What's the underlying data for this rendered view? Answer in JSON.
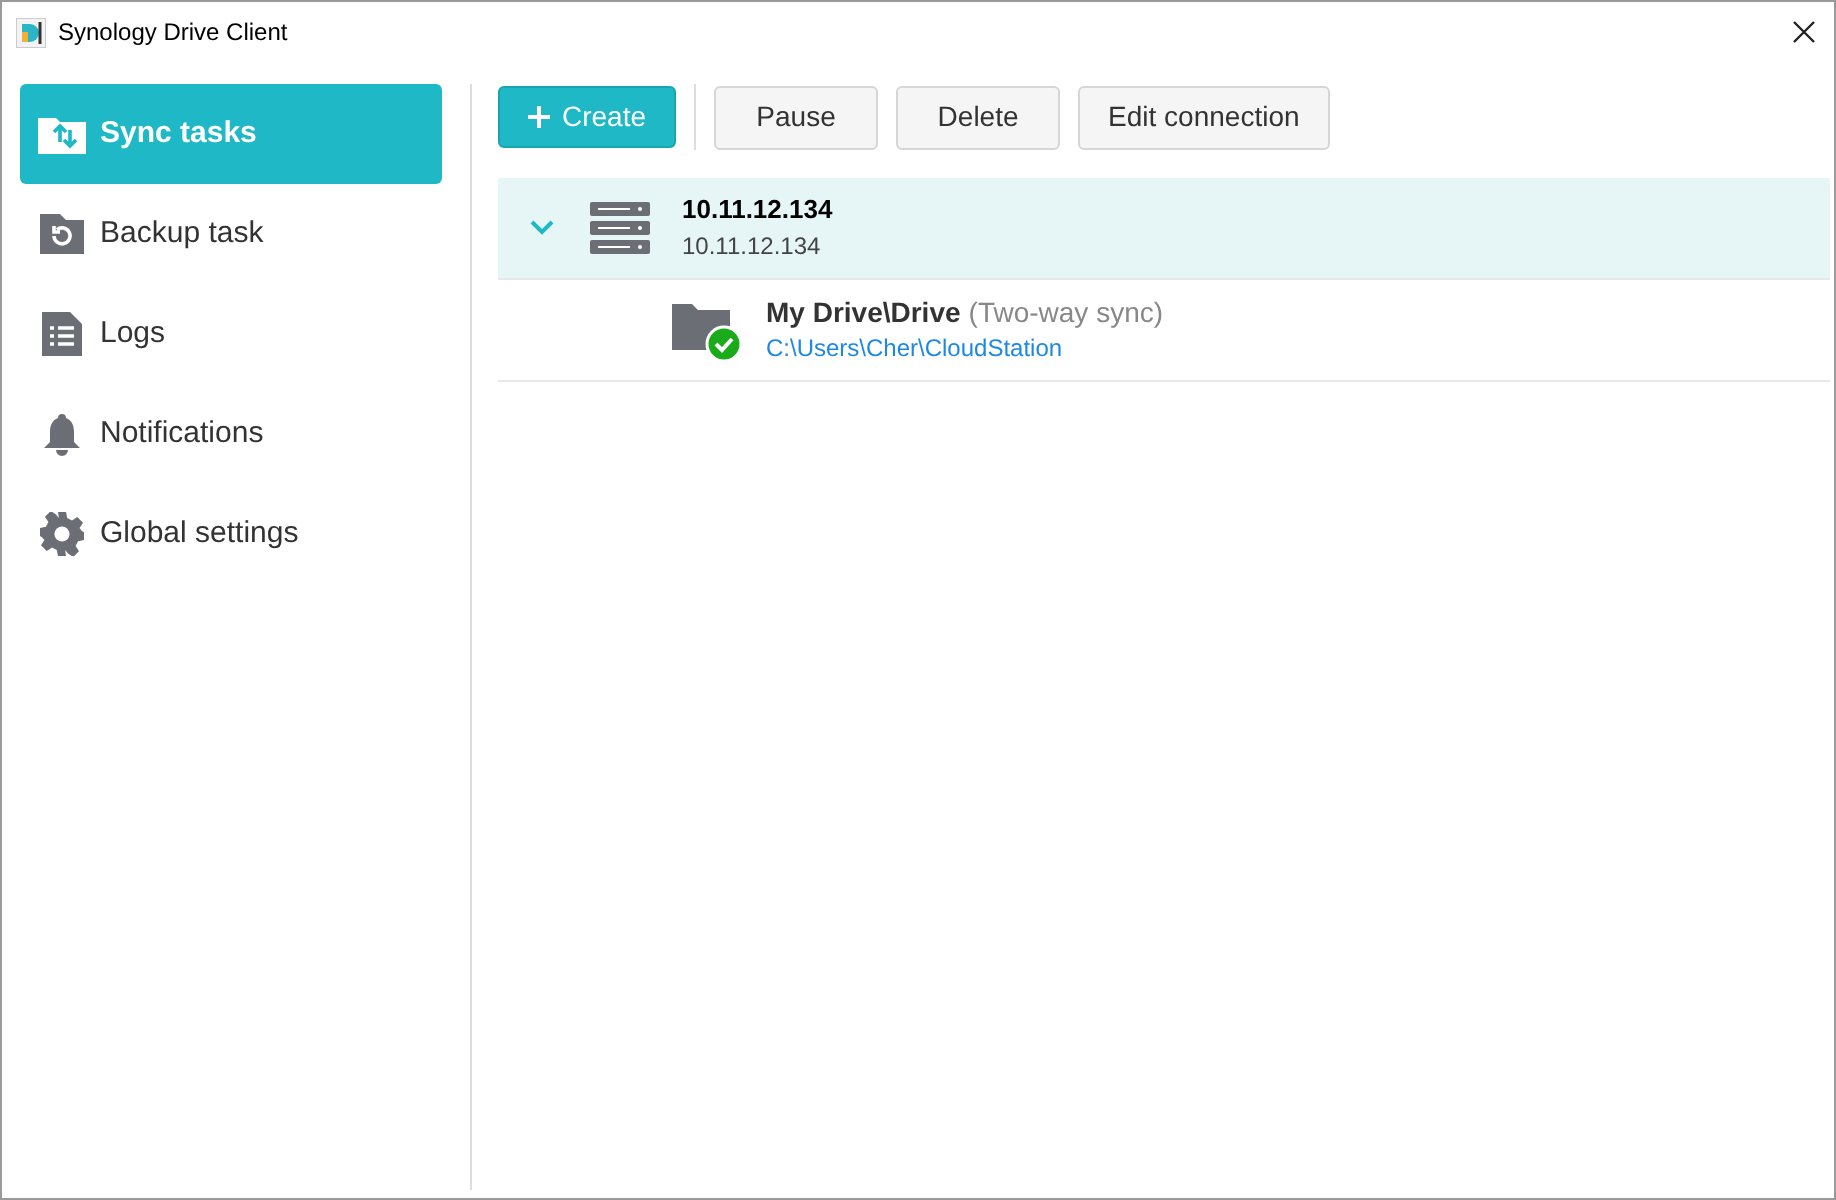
{
  "window": {
    "title": "Synology Drive Client"
  },
  "sidebar": {
    "items": [
      {
        "label": "Sync tasks",
        "selected": true
      },
      {
        "label": "Backup task",
        "selected": false
      },
      {
        "label": "Logs",
        "selected": false
      },
      {
        "label": "Notifications",
        "selected": false
      },
      {
        "label": "Global settings",
        "selected": false
      }
    ]
  },
  "toolbar": {
    "buttons": [
      {
        "label": "Create",
        "kind": "primary"
      },
      {
        "label": "Pause",
        "kind": "normal"
      },
      {
        "label": "Delete",
        "kind": "normal"
      },
      {
        "label": "Edit connection",
        "kind": "normal"
      }
    ]
  },
  "servers": [
    {
      "name": "10.11.12.134",
      "address": "10.11.12.134",
      "expanded": true,
      "selected": true,
      "tasks": [
        {
          "name": "My Drive\\Drive",
          "mode": "(Two-way sync)",
          "path": "C:\\Users\\Cher\\CloudStation",
          "synced": true
        }
      ]
    }
  ]
}
